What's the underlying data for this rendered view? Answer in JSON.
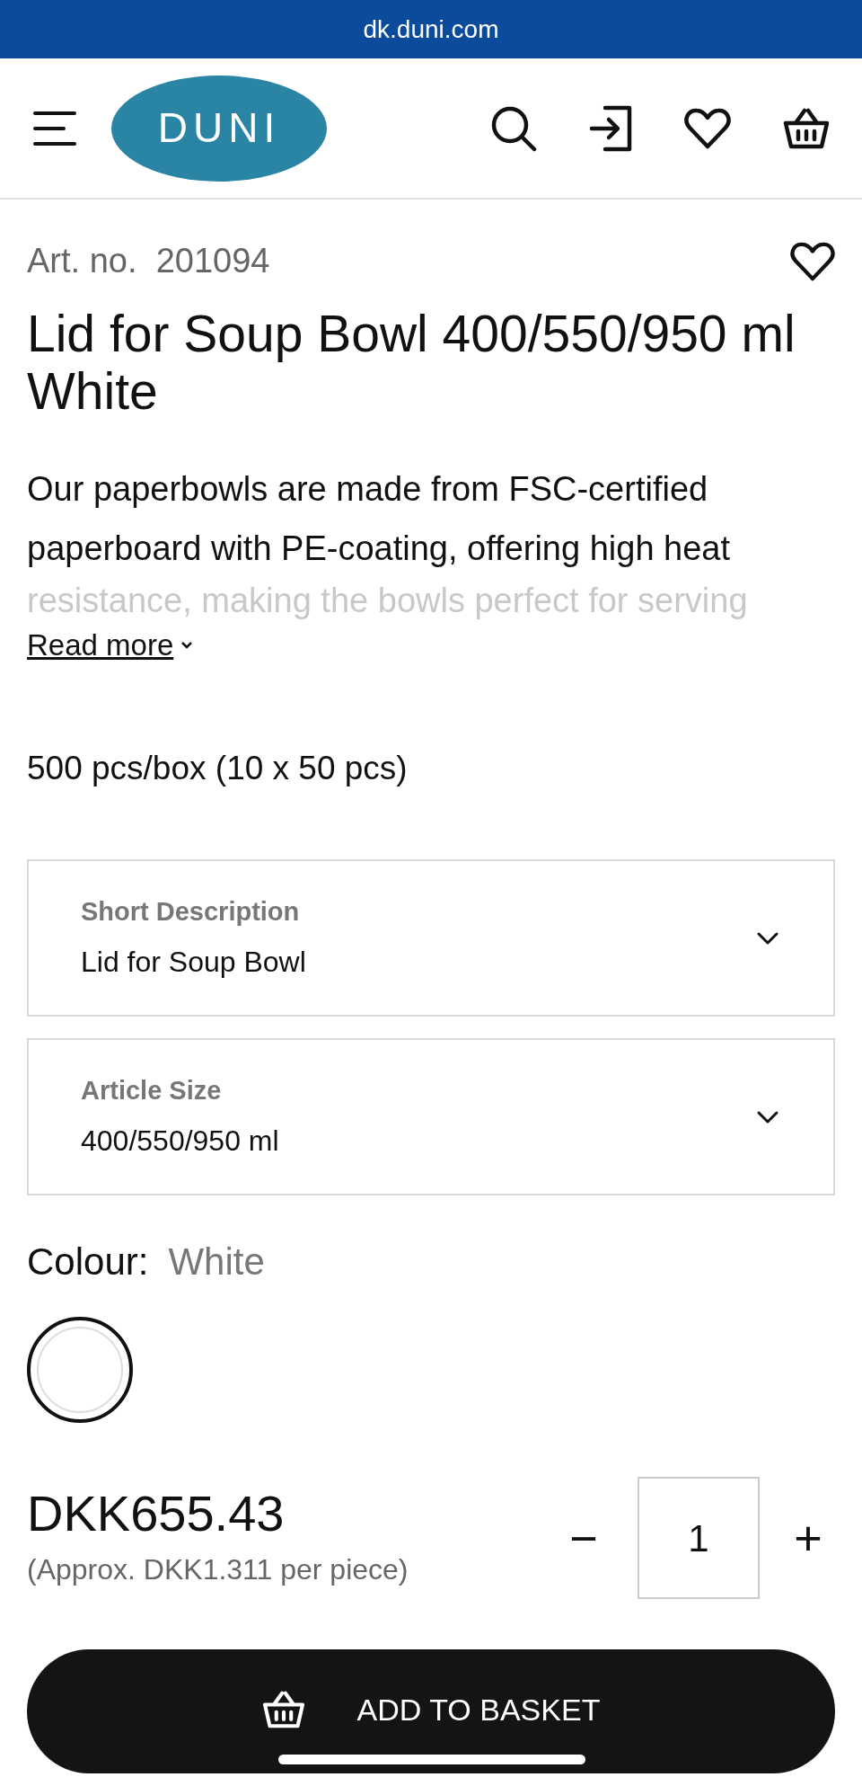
{
  "address_bar": {
    "url": "dk.duni.com"
  },
  "header": {
    "logo": "DUNI"
  },
  "product": {
    "art_no_label": "Art. no.",
    "art_no": "201094",
    "favourite": false,
    "title": "Lid for Soup Bowl 400/550/950 ml White",
    "description": [
      "Our paperbowls are made from FSC-certified",
      "paperboard with PE-coating, offering high heat",
      "resistance, making the bowls perfect for serving"
    ],
    "read_more": "Read more",
    "packaging": "500 pcs/box (10 x 50 pcs)"
  },
  "selects": [
    {
      "label": "Short Description",
      "value": "Lid for Soup Bowl"
    },
    {
      "label": "Article Size",
      "value": "400/550/950 ml"
    }
  ],
  "colour": {
    "label": "Colour:",
    "value": "White",
    "swatches": [
      {
        "color": "#ffffff",
        "selected": true
      }
    ]
  },
  "price": {
    "amount": "DKK655.43",
    "per_piece": "(Approx. DKK1.311 per piece)"
  },
  "quantity": {
    "minus": "−",
    "value": "1",
    "plus": "+"
  },
  "add_button": "ADD TO BASKET"
}
